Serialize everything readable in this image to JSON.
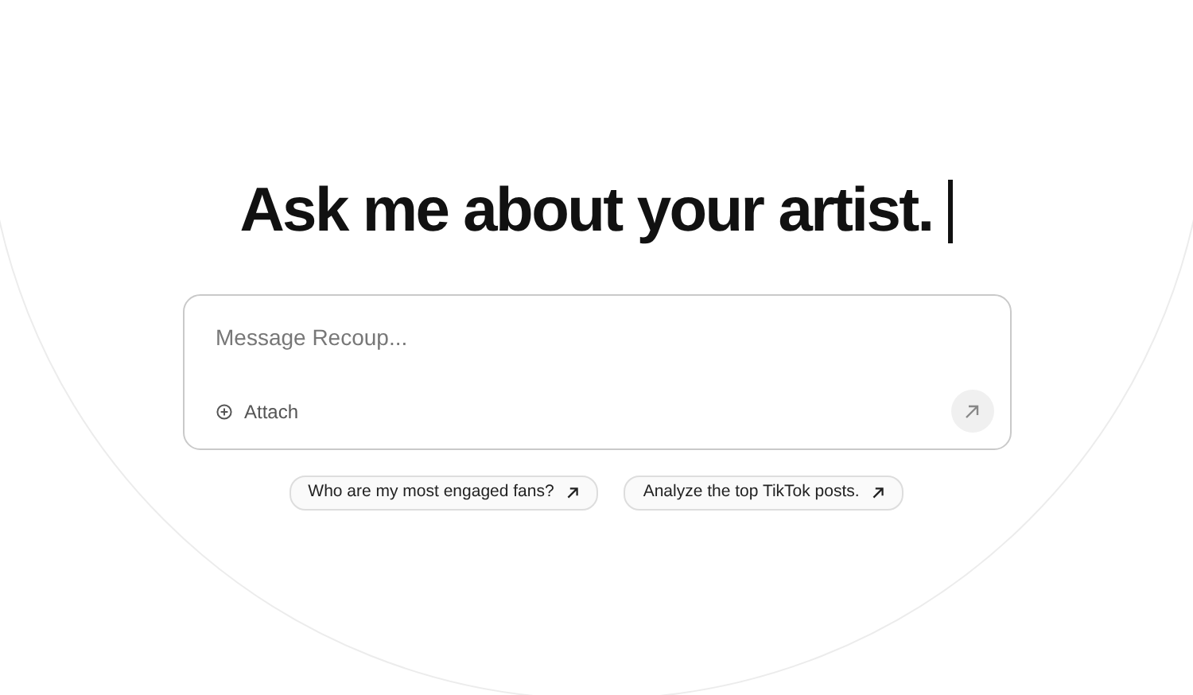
{
  "heading": {
    "text": "Ask me about your artist.",
    "cursor": true
  },
  "composer": {
    "placeholder": "Message Recoup...",
    "attach_label": "Attach"
  },
  "suggestions": [
    {
      "label": "Who are my most engaged fans?"
    },
    {
      "label": "Analyze the top TikTok posts."
    }
  ]
}
